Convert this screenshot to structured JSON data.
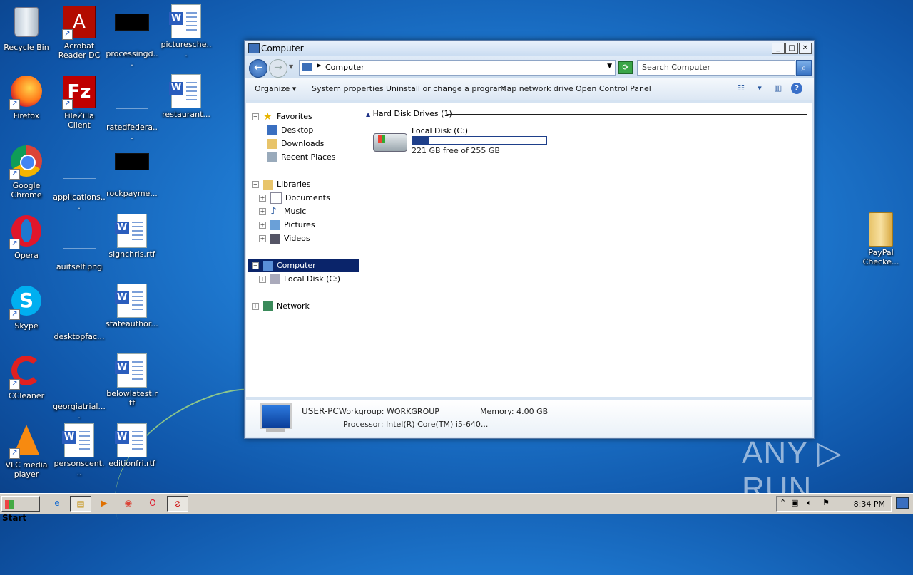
{
  "desktop": {
    "icons": [
      {
        "label": "Recycle Bin"
      },
      {
        "label": "Acrobat Reader DC"
      },
      {
        "label": "processingd..."
      },
      {
        "label": "picturesche..."
      },
      {
        "label": "Firefox"
      },
      {
        "label": "FileZilla Client"
      },
      {
        "label": "ratedfedera..."
      },
      {
        "label": "restaurant..."
      },
      {
        "label": "Google Chrome"
      },
      {
        "label": "applications..."
      },
      {
        "label": "rockpayme..."
      },
      {
        "label": "Opera"
      },
      {
        "label": "auitself.png"
      },
      {
        "label": "signchris.rtf"
      },
      {
        "label": "Skype"
      },
      {
        "label": "desktopfac..."
      },
      {
        "label": "stateauthor..."
      },
      {
        "label": "CCleaner"
      },
      {
        "label": "georgiatrial...."
      },
      {
        "label": "belowlatest.rtf"
      },
      {
        "label": "VLC media player"
      },
      {
        "label": "personscent..."
      },
      {
        "label": "editionfri.rtf"
      },
      {
        "label": "PayPal Checke..."
      }
    ]
  },
  "window": {
    "title": "Computer",
    "address": "Computer",
    "search_placeholder": "Search Computer",
    "commands": [
      "Organize ▾",
      "System properties",
      "Uninstall or change a program",
      "Map network drive",
      "Open Control Panel"
    ],
    "nav": {
      "favorites": "Favorites",
      "desktop": "Desktop",
      "downloads": "Downloads",
      "recent": "Recent Places",
      "libraries": "Libraries",
      "documents": "Documents",
      "music": "Music",
      "pictures": "Pictures",
      "videos": "Videos",
      "computer": "Computer",
      "localdisk": "Local Disk (C:)",
      "network": "Network"
    },
    "group_header": "Hard Disk Drives (1)",
    "drive": {
      "name": "Local Disk (C:)",
      "free_text": "221 GB free of 255 GB",
      "used_fraction": 0.13
    },
    "details": {
      "pc_name": "USER-PC",
      "workgroup": "Workgroup: WORKGROUP",
      "memory": "Memory: 4.00 GB",
      "processor": "Processor: Intel(R) Core(TM) i5-640..."
    }
  },
  "taskbar": {
    "start": "Start",
    "clock": "8:34 PM"
  },
  "watermark": "ANY ▷ RUN"
}
